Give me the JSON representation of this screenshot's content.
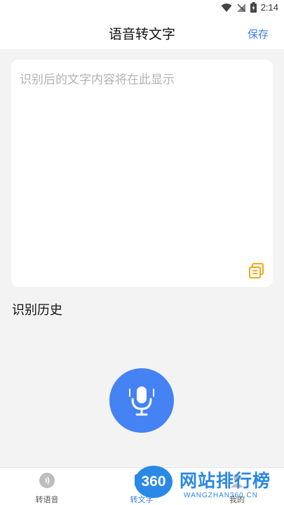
{
  "status_bar": {
    "time": "2:14"
  },
  "header": {
    "title": "语音转文字",
    "save_label": "保存"
  },
  "text_area": {
    "placeholder": "识别后的文字内容将在此显示"
  },
  "history": {
    "title": "识别历史"
  },
  "bottom_nav": {
    "items": [
      {
        "label": "转语音",
        "icon": "sound-icon",
        "active": false
      },
      {
        "label": "转文字",
        "icon": "text-icon",
        "active": true
      },
      {
        "label": "我的",
        "icon": "profile-icon",
        "active": false
      }
    ]
  },
  "watermark": {
    "logo": "360",
    "title": "网站排行榜",
    "subtitle": "WANGZHAN360.CN"
  },
  "colors": {
    "accent": "#4582f4",
    "save": "#3d7cf2",
    "copy_icon": "#f2a71b",
    "watermark": "#2a88e6"
  }
}
